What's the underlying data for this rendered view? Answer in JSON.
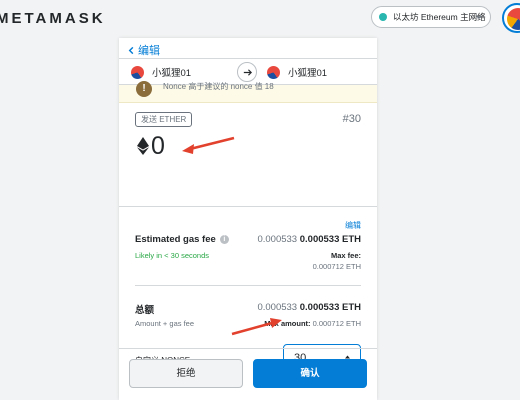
{
  "app": {
    "brand": "METAMASK"
  },
  "network": {
    "label": "以太坊 Ethereum 主网络",
    "dot_color": "#29b6af"
  },
  "header": {
    "back_label": "编辑"
  },
  "accounts": {
    "from": "小狐狸01",
    "to": "小狐狸01"
  },
  "banner": {
    "text": "Nonce 高于建议的 nonce 值 18",
    "icon": "!"
  },
  "summary": {
    "tx_type": "发送 ETHER",
    "nonce_tag": "#30",
    "amount": "0"
  },
  "gas": {
    "edit_label": "编辑",
    "label": "Estimated gas fee",
    "value_muted": "0.000533",
    "value_bold": "0.000533 ETH",
    "time_estimate": "Likely in < 30 seconds",
    "max_fee_label": "Max fee:",
    "max_fee_value": "0.000712 ETH"
  },
  "total": {
    "label": "总额",
    "value_muted": "0.000533",
    "value_bold": "0.000533 ETH",
    "sub_label": "Amount + gas fee",
    "max_amount_label": "Max amount:",
    "max_amount_value": "0.000712 ETH"
  },
  "nonce": {
    "label": "自定义 NONCE",
    "value": "30"
  },
  "footer": {
    "reject_label": "拒绝",
    "confirm_label": "确认"
  },
  "colors": {
    "accent": "#037dd6",
    "success": "#28a745",
    "annotation": "#e2412e",
    "banner_bg": "#fefae8"
  }
}
